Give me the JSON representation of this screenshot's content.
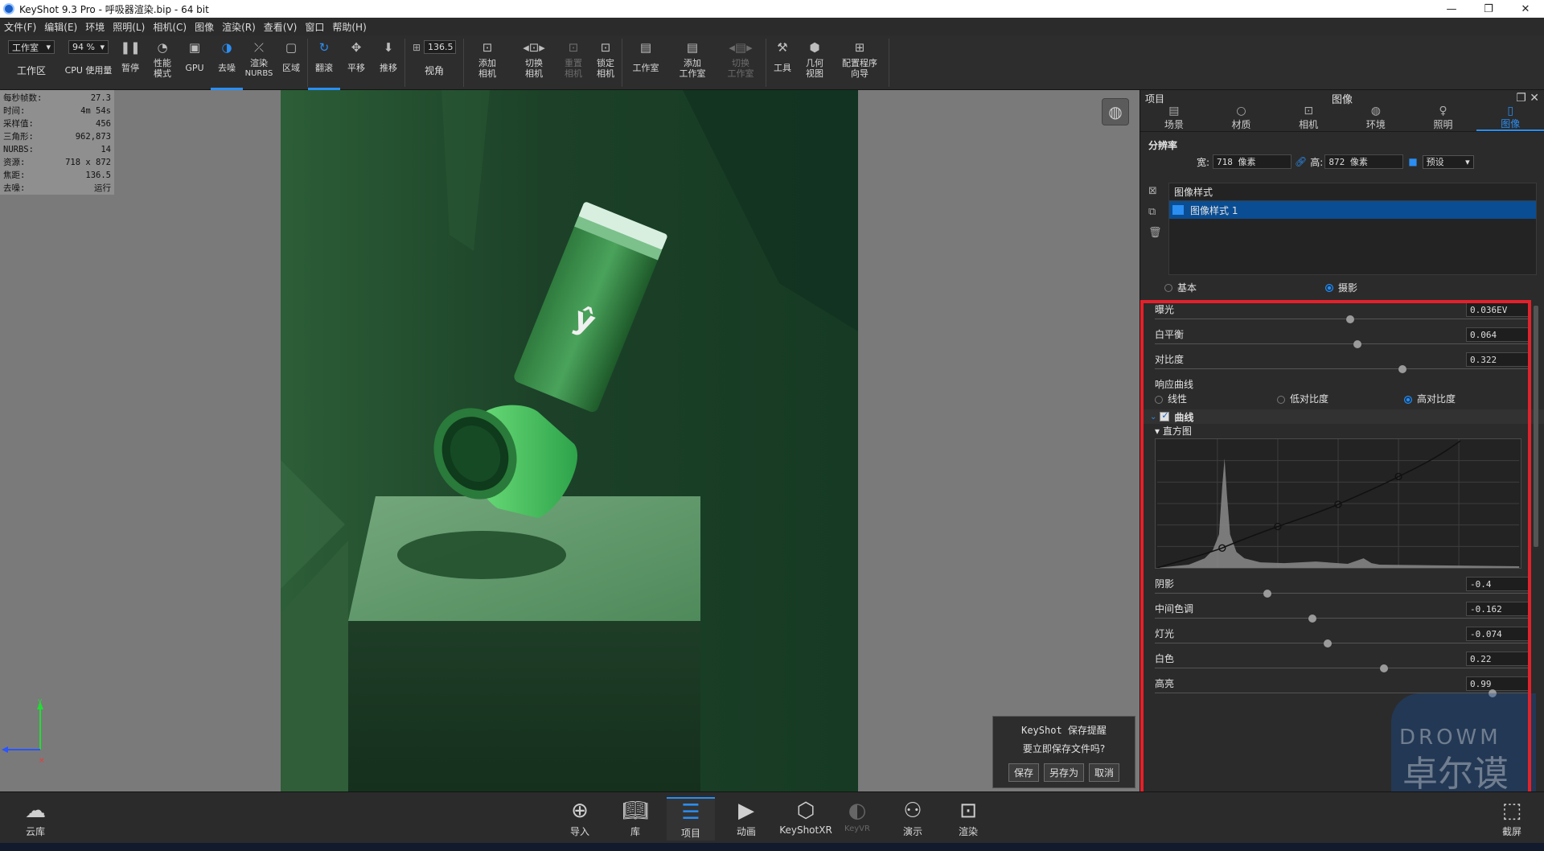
{
  "window": {
    "title": "KeyShot 9.3 Pro  - 呼吸器渲染.bip  - 64 bit"
  },
  "menu": [
    "文件(F)",
    "编辑(E)",
    "环境",
    "照明(L)",
    "相机(C)",
    "图像",
    "渲染(R)",
    "查看(V)",
    "窗口",
    "帮助(H)"
  ],
  "toolbar": {
    "workspace_combo": "工作室",
    "workspace_label": "工作区",
    "cpu_combo": "94 %",
    "cpu_label": "CPU 使用量",
    "pause": "暂停",
    "perf_mode_1": "性能",
    "perf_mode_2": "模式",
    "gpu": "GPU",
    "denoise": "去噪",
    "nurbs_1": "渲染",
    "nurbs_2": "NURBS",
    "region": "区域",
    "tumble": "翻滚",
    "pan": "平移",
    "dolly": "推移",
    "fov_value": "136.5",
    "fov_label": "视角",
    "add_camera_1": "添加",
    "add_camera_2": "相机",
    "switch_camera_1": "切换",
    "switch_camera_2": "相机",
    "reset_camera_1": "重置",
    "reset_camera_2": "相机",
    "lock_camera_1": "锁定",
    "lock_camera_2": "相机",
    "studio": "工作室",
    "add_studio_1": "添加",
    "add_studio_2": "工作室",
    "switch_studio_1": "切换",
    "switch_studio_2": "工作室",
    "tools": "工具",
    "geometry_view_1": "几何",
    "geometry_view_2": "视图",
    "config_wizard_1": "配置程序",
    "config_wizard_2": "向导"
  },
  "stats": [
    {
      "k": "每秒帧数:",
      "v": "27.3"
    },
    {
      "k": "时间:",
      "v": "4m 54s"
    },
    {
      "k": "采样值:",
      "v": "456"
    },
    {
      "k": "三角形:",
      "v": "962,873"
    },
    {
      "k": "NURBS:",
      "v": "14"
    },
    {
      "k": "资源:",
      "v": "718 x 872"
    },
    {
      "k": "焦距:",
      "v": "136.5"
    },
    {
      "k": "去噪:",
      "v": "运行"
    }
  ],
  "notify": {
    "title": "KeyShot 保存提醒",
    "message": "要立即保存文件吗?",
    "save": "保存",
    "save_as": "另存为",
    "cancel": "取消"
  },
  "panel": {
    "left_label": "项目",
    "title": "图像",
    "tabs": [
      "场景",
      "材质",
      "相机",
      "环境",
      "照明",
      "图像"
    ],
    "resolution_title": "分辨率",
    "width_label": "宽:",
    "width_value": "718 像素",
    "height_label": "高:",
    "height_value": "872 像素",
    "preset": "预设",
    "style_header": "图像样式",
    "style_selected": "图像样式 1",
    "mode_basic": "基本",
    "mode_photo": "摄影",
    "params_top": [
      {
        "label": "曝光",
        "value": "0.036EV",
        "pos": 0.52
      },
      {
        "label": "白平衡",
        "value": "0.064",
        "pos": 0.54
      },
      {
        "label": "对比度",
        "value": "0.322",
        "pos": 0.66
      }
    ],
    "response_curve": "响应曲线",
    "curve_linear": "线性",
    "curve_low": "低对比度",
    "curve_high": "高对比度",
    "curve_section": "曲线",
    "histogram": "直方图",
    "params_bottom": [
      {
        "label": "阴影",
        "value": "-0.4",
        "pos": 0.3
      },
      {
        "label": "中间色调",
        "value": "-0.162",
        "pos": 0.42
      },
      {
        "label": "灯光",
        "value": "-0.074",
        "pos": 0.46
      },
      {
        "label": "白色",
        "value": "0.22",
        "pos": 0.61
      },
      {
        "label": "高亮",
        "value": "0.99",
        "pos": 0.9
      }
    ]
  },
  "watermark": {
    "line1": "DROWM",
    "line2": "卓尔谟"
  },
  "bottom": {
    "cloud": "云库",
    "import": "导入",
    "library": "库",
    "project": "项目",
    "animation": "动画",
    "keyshotxr": "KeyShotXR",
    "keyvr": "KeyVR",
    "present": "演示",
    "render": "渲染",
    "screenshot": "截屏"
  },
  "colors": {
    "accent": "#2b8ef2",
    "highlight_box": "#e3212b",
    "selection": "#0a4d92"
  }
}
